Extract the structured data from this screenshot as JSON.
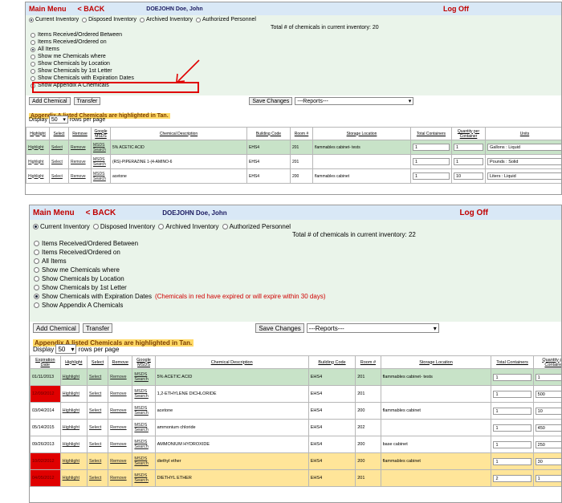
{
  "colors": {
    "header_bg": "#d9e8f6",
    "menu_red": "#c00000",
    "green_row": "#c8e3c8",
    "tan_row": "#ffe599",
    "expired_red": "#e00000",
    "panel_green": "#eaf4ea"
  },
  "top": {
    "header": {
      "main_menu": "Main Menu",
      "back": "< BACK",
      "user": "DOEJOHN  Doe, John",
      "logoff": "Log Off"
    },
    "tabs": [
      "Current Inventory",
      "Disposed Inventory",
      "Archived Inventory",
      "Authorized Personnel"
    ],
    "total": "Total # of chemicals in current inventory: 20",
    "options": [
      "Items Received/Ordered Between",
      "Items Received/Ordered on",
      "All Items",
      "Show me Chemicals where",
      "Show Chemicals by Location",
      "Show Chemicals by 1st Letter",
      "Show Chemicals with Expiration Dates",
      "Show Appendix A Chemicals"
    ],
    "add_chemical": "Add Chemical",
    "transfer": "Transfer",
    "save_changes": "Save Changes",
    "reports": "---Reports---",
    "appendix": "Appendix A listed Chemicals are highlighted in Tan.",
    "display_label": "Display",
    "rows_value": "50",
    "rows_label": "rows per page",
    "columns": [
      "Highlight",
      "Select",
      "Remove",
      "Google MSDS",
      "Chemical Description",
      "Building Code",
      "Room #",
      "Storage Location",
      "Total Containers",
      "Quantity per Container",
      "Units"
    ],
    "rows": [
      {
        "highlight": "Highlight",
        "select": "Select",
        "remove": "Remove",
        "msds": "MSDS Search",
        "desc": "5% ACETIC ACID",
        "bldg": "EHS4",
        "room": "201",
        "storage": "flammables cabinet- tests",
        "total": "1",
        "qty": "1",
        "units": "Gallons : Liquid",
        "style": "green"
      },
      {
        "highlight": "Highlight",
        "select": "Select",
        "remove": "Remove",
        "msds": "MSDS Search",
        "desc": "(RS)-PIPERAZINE 1-(4-AMINO-6",
        "bldg": "EHS4",
        "room": "201",
        "storage": "",
        "total": "1",
        "qty": "1",
        "units": "Pounds : Solid",
        "style": ""
      },
      {
        "highlight": "Highlight",
        "select": "Select",
        "remove": "Remove",
        "msds": "MSDS Search",
        "desc": "acetone",
        "bldg": "EHS4",
        "room": "200",
        "storage": "flammables cabinet",
        "total": "1",
        "qty": "10",
        "units": "Liters : Liquid",
        "style": ""
      }
    ]
  },
  "bottom": {
    "header": {
      "main_menu": "Main Menu",
      "back": "< BACK",
      "user": "DOEJOHN  Doe, John",
      "logoff": "Log Off"
    },
    "tabs": [
      "Current Inventory",
      "Disposed Inventory",
      "Archived Inventory",
      "Authorized Personnel"
    ],
    "total": "Total # of chemicals in current inventory: 22",
    "options": [
      "Items Received/Ordered Between",
      "Items Received/Ordered on",
      "All Items",
      "Show me Chemicals where",
      "Show Chemicals by Location",
      "Show Chemicals by 1st Letter",
      "Show Chemicals with Expiration Dates",
      "Show Appendix A Chemicals"
    ],
    "expire_note": "(Chemicals in red have expired or will expire within 30 days)",
    "add_chemical": "Add Chemical",
    "transfer": "Transfer",
    "save_changes": "Save Changes",
    "reports": "---Reports---",
    "appendix": "Appendix A listed Chemicals are highlighted in Tan.",
    "display_label": "Display",
    "rows_value": "50",
    "rows_label": "rows per page",
    "columns": [
      "Expiration Date",
      "Highlight",
      "Select",
      "Remove",
      "Google MSDS",
      "Chemical Description",
      "Building Code",
      "Room #",
      "Storage Location",
      "Total Containers",
      "Quantity per Container"
    ],
    "rows": [
      {
        "exp": "01/11/2013",
        "highlight": "Highlight",
        "select": "Select",
        "remove": "Remove",
        "msds": "MSDS Search",
        "desc": "5% ACETIC ACID",
        "bldg": "EHS4",
        "room": "201",
        "storage": "flammables cabinet- tests",
        "total": "1",
        "qty": "1",
        "style": "green",
        "expired": false
      },
      {
        "exp": "12/09/2012",
        "highlight": "Highlight",
        "select": "Select",
        "remove": "Remove",
        "msds": "MSDS Search",
        "desc": "1,2-ETHYLENE DICHLORIDE",
        "bldg": "EHS4",
        "room": "201",
        "storage": "",
        "total": "1",
        "qty": "500",
        "style": "",
        "expired": true
      },
      {
        "exp": "03/04/2014",
        "highlight": "Highlight",
        "select": "Select",
        "remove": "Remove",
        "msds": "MSDS Search",
        "desc": "acetone",
        "bldg": "EHS4",
        "room": "200",
        "storage": "flammables cabinet",
        "total": "1",
        "qty": "10",
        "style": "",
        "expired": false
      },
      {
        "exp": "05/14/2015",
        "highlight": "Highlight",
        "select": "Select",
        "remove": "Remove",
        "msds": "MSDS Search",
        "desc": "ammonium chloride",
        "bldg": "EHS4",
        "room": "202",
        "storage": "",
        "total": "1",
        "qty": "450",
        "style": "",
        "expired": false
      },
      {
        "exp": "09/26/2013",
        "highlight": "Highlight",
        "select": "Select",
        "remove": "Remove",
        "msds": "MSDS Search",
        "desc": "AMMONIUM HYDROXIDE",
        "bldg": "EHS4",
        "room": "200",
        "storage": "base cabinet",
        "total": "1",
        "qty": "250",
        "style": "",
        "expired": false
      },
      {
        "exp": "10/02/2012",
        "highlight": "Highlight",
        "select": "Select",
        "remove": "Remove",
        "msds": "MSDS Search",
        "desc": "diethyl ether",
        "bldg": "EHS4",
        "room": "200",
        "storage": "flammables cabinet",
        "total": "1",
        "qty": "30",
        "style": "tan",
        "expired": true
      },
      {
        "exp": "04/05/2012",
        "highlight": "Highlight",
        "select": "Select",
        "remove": "Remove",
        "msds": "MSDS Search",
        "desc": "DIETHYL ETHER",
        "bldg": "EHS4",
        "room": "201",
        "storage": "",
        "total": "2",
        "qty": "1",
        "style": "tan",
        "expired": true
      }
    ]
  }
}
